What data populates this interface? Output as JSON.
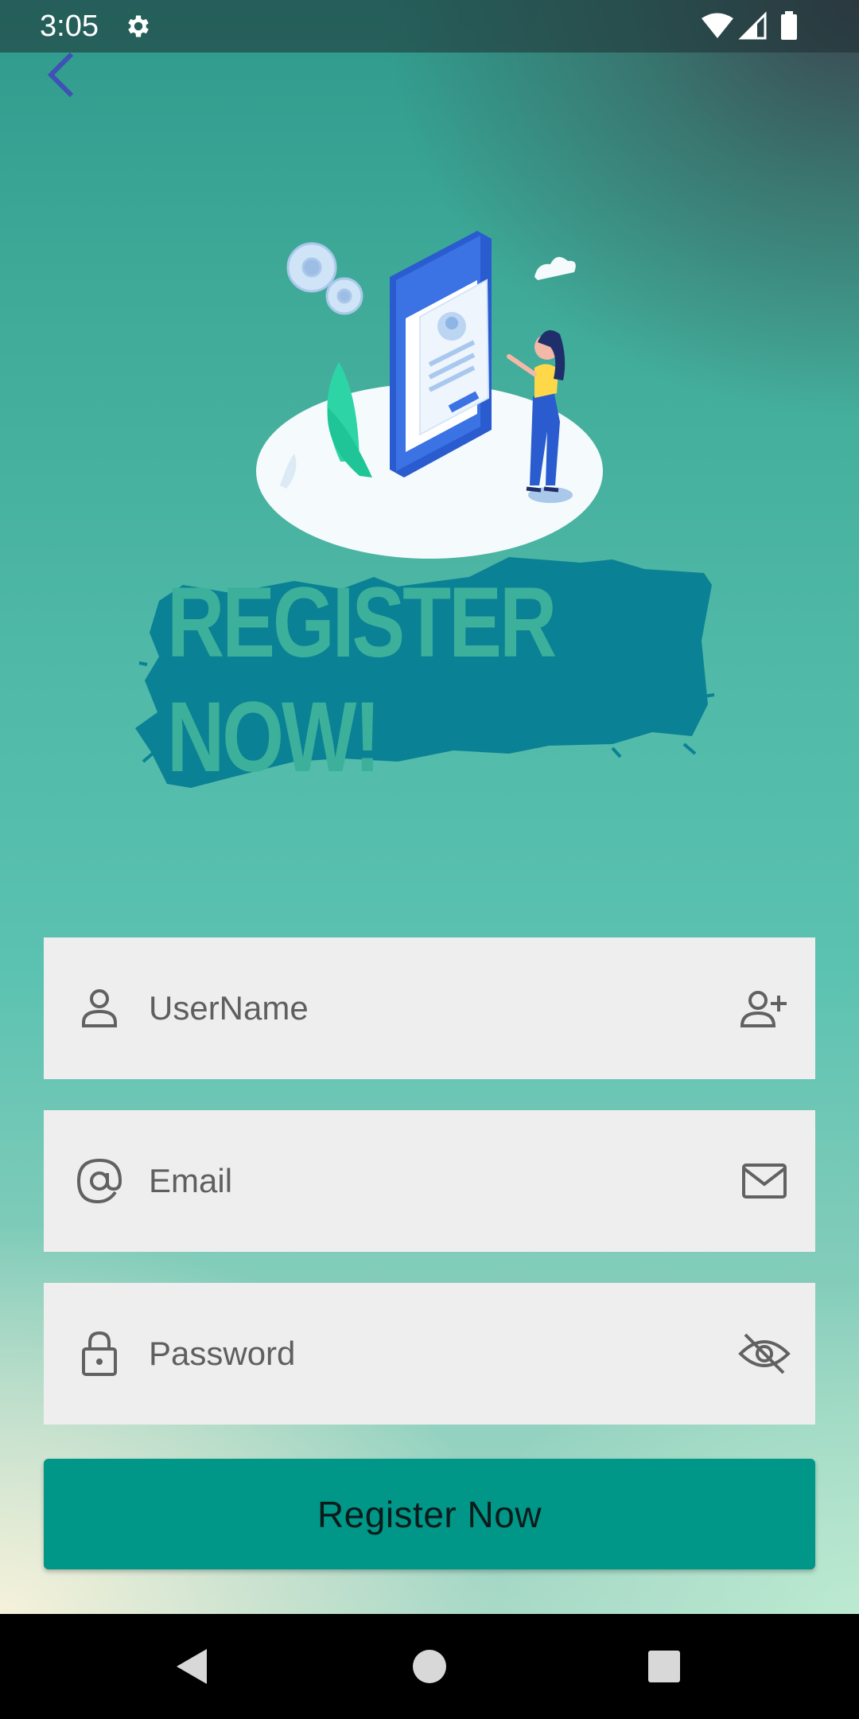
{
  "status_bar": {
    "time": "3:05",
    "icons": [
      "gear-icon",
      "wifi-icon",
      "signal-icon",
      "battery-icon"
    ]
  },
  "header": {
    "back_icon": "chevron-left-icon"
  },
  "banner": {
    "text": "REGISTER NOW!"
  },
  "form": {
    "username": {
      "placeholder": "UserName",
      "lead_icon": "person-icon",
      "trail_icon": "add-person-icon"
    },
    "email": {
      "placeholder": "Email",
      "lead_icon": "at-icon",
      "trail_icon": "mail-icon"
    },
    "password": {
      "placeholder": "Password",
      "lead_icon": "lock-icon",
      "trail_icon": "eye-off-icon"
    },
    "submit_label": "Register Now"
  },
  "nav_bar": {
    "buttons": [
      "back-triangle-icon",
      "home-circle-icon",
      "recents-square-icon"
    ]
  },
  "colors": {
    "accent": "#009688",
    "back_arrow": "#3f51b5",
    "banner_brush": "#0a8195",
    "banner_text": "#3cb09a",
    "field_bg": "#eeeeee"
  }
}
